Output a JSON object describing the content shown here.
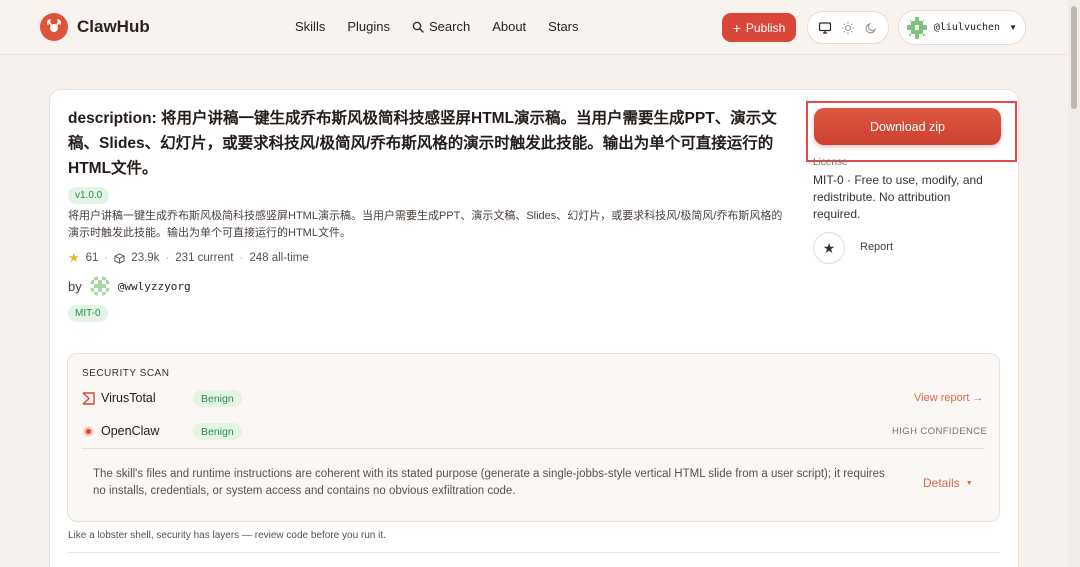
{
  "header": {
    "logo_text": "ClawHub",
    "nav": [
      {
        "label": "Skills"
      },
      {
        "label": "Plugins"
      },
      {
        "label": "Search"
      },
      {
        "label": "About"
      },
      {
        "label": "Stars"
      }
    ],
    "publish_label": "Publish",
    "user_name": "@liulvuchen"
  },
  "skill": {
    "title": "description: 将用户讲稿一键生成乔布斯风极简科技感竖屏HTML演示稿。当用户需要生成PPT、演示文稿、Slides、幻灯片，或要求科技风/极简风/乔布斯风格的演示时触发此技能。输出为单个可直接运行的HTML文件。",
    "version": "v1.0.0",
    "description": "将用户讲稿一键生成乔布斯风极简科技感竖屏HTML演示稿。当用户需要生成PPT、演示文稿、Slides、幻灯片，或要求科技风/极简风/乔布斯风格的演示时触发此技能。输出为单个可直接运行的HTML文件。",
    "stars": "61",
    "downloads": "23.9k",
    "current": "231 current",
    "all_time": "248 all-time",
    "by_label": "by",
    "author": "@wwlyzzyorg",
    "license_badge": "MIT-0"
  },
  "sidebar": {
    "download_label": "Download zip",
    "license_label": "License",
    "license_text": "MIT-0 · Free to use, modify, and redistribute. No attribution required.",
    "star_icon": "★",
    "report_label": "Report"
  },
  "security": {
    "title": "SECURITY SCAN",
    "scanners": [
      {
        "name": "VirusTotal",
        "status": "Benign"
      },
      {
        "name": "OpenClaw",
        "status": "Benign"
      }
    ],
    "view_report": "View report →",
    "confidence": "HIGH CONFIDENCE",
    "summary": "The skill's files and runtime instructions are coherent with its stated purpose (generate a single-jobbs-style vertical HTML slide from a user script); it requires no installs, credentials, or system access and contains no obvious exfiltration code.",
    "details_label": "Details",
    "footnote": "Like a lobster shell, security has layers — review code before you run it."
  },
  "colors": {
    "accent": "#d9473a",
    "benign_bg": "#e3f4e6",
    "benign_text": "#2f8a4a",
    "highlight": "#e44848"
  }
}
